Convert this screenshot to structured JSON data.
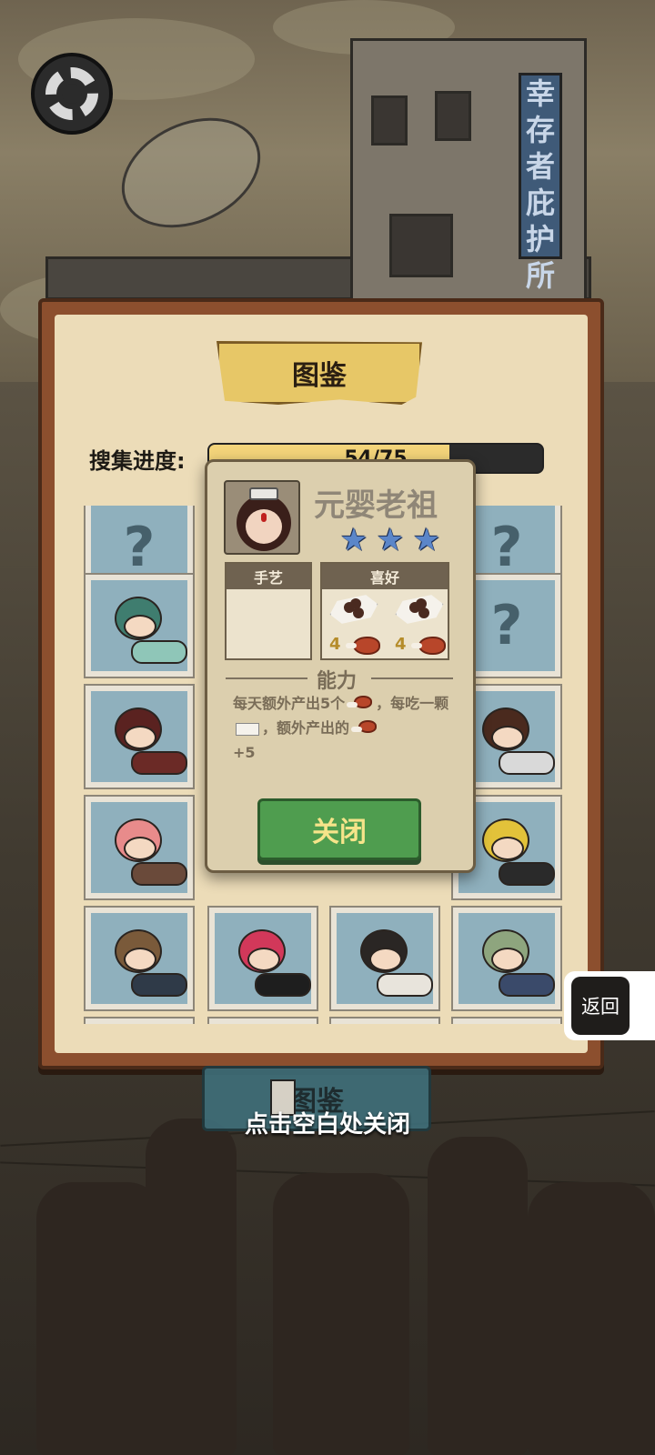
{
  "background": {
    "shelter_sign": "幸存者庇护所"
  },
  "album": {
    "title": "图鉴",
    "progress_label": "搜集进度:",
    "progress_text": "54/75",
    "progress_fraction": 0.72
  },
  "grid": {
    "cards": [
      {
        "kind": "unknown",
        "symbol": "?"
      },
      {
        "kind": "unknown",
        "symbol": "?"
      },
      {
        "kind": "character",
        "hair": "#3f7d6f",
        "body": "#8fc6b8"
      },
      {
        "kind": "unknown",
        "symbol": "?"
      },
      {
        "kind": "character",
        "hair": "#5a2220",
        "body": "#6b2a26"
      },
      {
        "kind": "character",
        "hair": "#4a2a1e",
        "body": "#d9d9d9"
      },
      {
        "kind": "character",
        "hair": "#e88b8b",
        "body": "#6a4a3a"
      },
      {
        "kind": "character",
        "hair": "#e2c23a",
        "body": "#2a2a2a"
      },
      {
        "kind": "character",
        "hair": "#7a5a3a",
        "body": "#2f3a48"
      },
      {
        "kind": "character",
        "hair": "#d2385a",
        "body": "#1e1e1e"
      },
      {
        "kind": "character",
        "hair": "#2a2624",
        "body": "#e8e4dc"
      },
      {
        "kind": "character",
        "hair": "#8ea57e",
        "body": "#3a4a6a"
      }
    ]
  },
  "detail": {
    "name": "元婴老祖",
    "stars": [
      "★",
      "★",
      "★"
    ],
    "skill_header": "手艺",
    "preference_header": "喜好",
    "preferences": [
      {
        "count": "4",
        "reward_icon": "meat-icon",
        "item_icon": "candy-icon"
      },
      {
        "count": "4",
        "reward_icon": "meat-icon",
        "item_icon": "candy-icon"
      }
    ],
    "ability_title": "能力",
    "ability_text_1": "每天额外产出5个",
    "ability_text_2": "，每吃一颗",
    "ability_text_3": "，额外产出的",
    "ability_text_4": "+5",
    "close_label": "关闭"
  },
  "bottom": {
    "tab_label": "图鉴",
    "tap_hint": "点击空白处关闭"
  },
  "return_label": "返回"
}
